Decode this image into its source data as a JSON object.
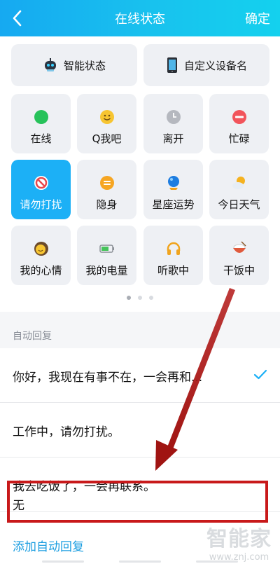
{
  "header": {
    "title": "在线状态",
    "confirm_label": "确定",
    "back_icon": "chevron-left-icon"
  },
  "top_tiles": [
    {
      "label": "智能状态",
      "icon": "robot-icon"
    },
    {
      "label": "自定义设备名",
      "icon": "phone-icon"
    }
  ],
  "status_tiles": [
    {
      "label": "在线",
      "icon": "green-dot-icon",
      "color": "#27c25a"
    },
    {
      "label": "Q我吧",
      "icon": "smiley-icon",
      "color": "#f7c531"
    },
    {
      "label": "离开",
      "icon": "clock-icon",
      "color": "#b5b8bf"
    },
    {
      "label": "忙碌",
      "icon": "minus-circle-icon",
      "color": "#f2545b"
    },
    {
      "label": "请勿打扰",
      "icon": "no-entry-icon",
      "color": "#e8474c",
      "active": true
    },
    {
      "label": "隐身",
      "icon": "hidden-icon",
      "color": "#f6a623"
    },
    {
      "label": "星座运势",
      "icon": "crystal-ball-icon",
      "color": "#1e7de0"
    },
    {
      "label": "今日天气",
      "icon": "weather-icon",
      "color": "#f5b21f"
    },
    {
      "label": "我的心情",
      "icon": "mood-icon",
      "color": "#6b4a2a"
    },
    {
      "label": "我的电量",
      "icon": "battery-icon",
      "color": "#46c35b"
    },
    {
      "label": "听歌中",
      "icon": "headphones-icon",
      "color": "#f0a41e"
    },
    {
      "label": "干饭中",
      "icon": "rice-bowl-icon",
      "color": "#e05a3c"
    }
  ],
  "pager": {
    "pages": 3,
    "current": 1
  },
  "auto_reply": {
    "section_title": "自动回复",
    "items": [
      {
        "text": "你好，我现在有事不在，一会再和...",
        "selected": true
      },
      {
        "text": "工作中，请勿打扰。",
        "selected": false
      },
      {
        "text": "我去吃饭了，一会再联系。",
        "selected": false
      },
      {
        "text": "无",
        "selected": false
      }
    ],
    "add_label": "添加自动回复"
  },
  "colors": {
    "accent": "#1cb0f6",
    "annotation": "#c8191a"
  },
  "watermark": {
    "line1": "智能家",
    "line2": "www.znj.com"
  }
}
